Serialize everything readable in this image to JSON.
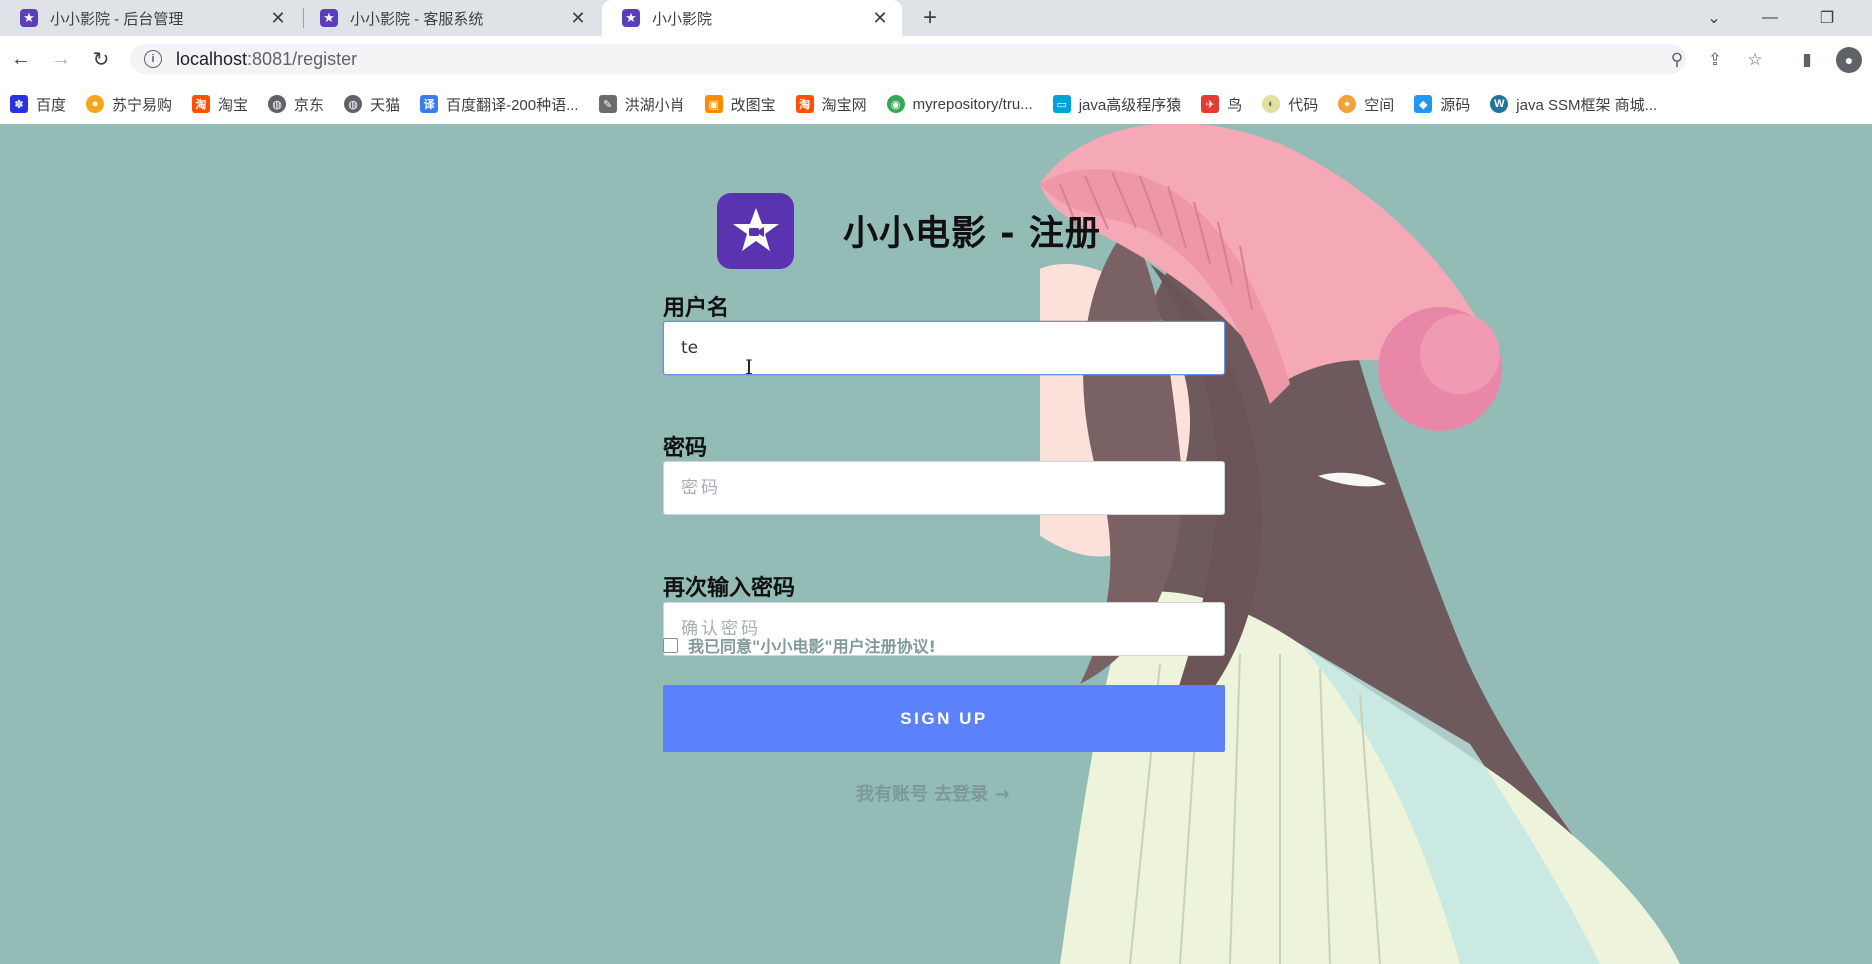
{
  "browser": {
    "tabs": [
      {
        "title": "小小影院 - 后台管理",
        "favicon": "star-icon"
      },
      {
        "title": "小小影院 - 客服系统",
        "favicon": "star-icon"
      },
      {
        "title": "小小影院",
        "favicon": "star-icon",
        "active": true
      }
    ],
    "url_host": "localhost",
    "url_path": ":8081/register",
    "bookmarks": [
      {
        "label": "百度",
        "icon": "baidu-paw-icon",
        "color": "#2932e1"
      },
      {
        "label": "苏宁易购",
        "icon": "suning-lion-icon",
        "color": "#f7a51c"
      },
      {
        "label": "淘宝",
        "icon": "taobao-icon",
        "color": "#ff5000"
      },
      {
        "label": "京东",
        "icon": "globe-icon",
        "color": "#5f6368"
      },
      {
        "label": "天猫",
        "icon": "globe-icon",
        "color": "#5f6368"
      },
      {
        "label": "百度翻译-200种语...",
        "icon": "translate-icon",
        "color": "#3a7cf0"
      },
      {
        "label": "洪湖小肖",
        "icon": "quill-icon",
        "color": "#6b6b6b"
      },
      {
        "label": "改图宝",
        "icon": "gaitubao-icon",
        "color": "#ff8a00"
      },
      {
        "label": "淘宝网",
        "icon": "taobao-icon",
        "color": "#ff5000"
      },
      {
        "label": "myrepository/tru...",
        "icon": "chrome-icon",
        "color": "#34a853"
      },
      {
        "label": "java高级程序猿",
        "icon": "bilibili-icon",
        "color": "#00a1d6"
      },
      {
        "label": "鸟",
        "icon": "bird-icon",
        "color": "#e53935"
      },
      {
        "label": "代码",
        "icon": "bulb-icon",
        "color": "#e0e0a0"
      },
      {
        "label": "空间",
        "icon": "qzone-icon",
        "color": "#f2a33a"
      },
      {
        "label": "源码",
        "icon": "docker-icon",
        "color": "#2496ed"
      },
      {
        "label": "java SSM框架 商城...",
        "icon": "wordpress-icon",
        "color": "#21759b"
      }
    ]
  },
  "page": {
    "title": "小小电影 - 注册",
    "username_label": "用户名",
    "username_value": "te",
    "password_label": "密码",
    "password_placeholder": "密码",
    "confirm_label": "再次输入密码",
    "confirm_placeholder": "确认密码",
    "agree_text": "我已同意\"小小电影\"用户注册协议!",
    "signup_label": "SIGN UP",
    "login_link": "我有账号 去登录 →",
    "colors": {
      "background": "#93bcb7",
      "button": "#5b82fa",
      "logo": "#5a34b0"
    }
  }
}
